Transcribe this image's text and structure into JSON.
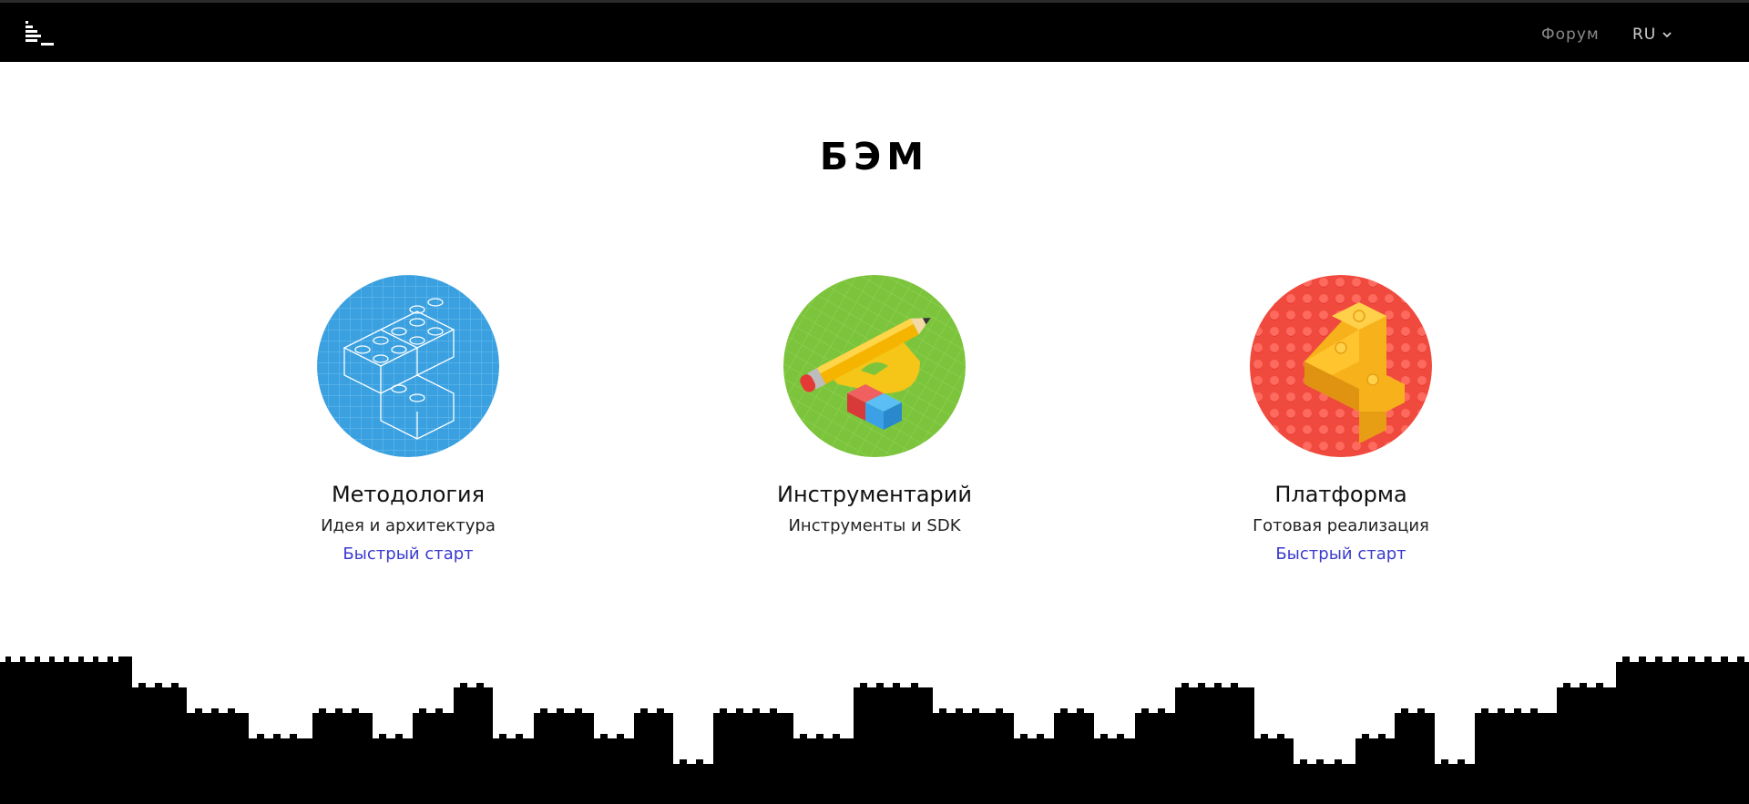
{
  "header": {
    "logo_icon": "bem-logo-icon",
    "nav_forum": "Форум",
    "lang": "RU",
    "lang_icon": "chevron-down-icon"
  },
  "page": {
    "title": "БЭМ"
  },
  "cards": [
    {
      "icon": "lego-blueprint-icon",
      "title": "Методология",
      "subtitle": "Идея и архитектура",
      "link": "Быстрый старт",
      "color": "#3aa0e0"
    },
    {
      "icon": "pencil-ruler-icon",
      "title": "Инструментарий",
      "subtitle": "Инструменты и SDK",
      "color": "#7cc43c"
    },
    {
      "icon": "lego-bricks-icon",
      "title": "Платформа",
      "subtitle": "Готовая реализация",
      "link": "Быстрый старт",
      "color": "#f04a3e"
    }
  ],
  "colors": {
    "header_bg": "#000000",
    "link": "#3a3acf",
    "footer_skyline": "#000000"
  }
}
